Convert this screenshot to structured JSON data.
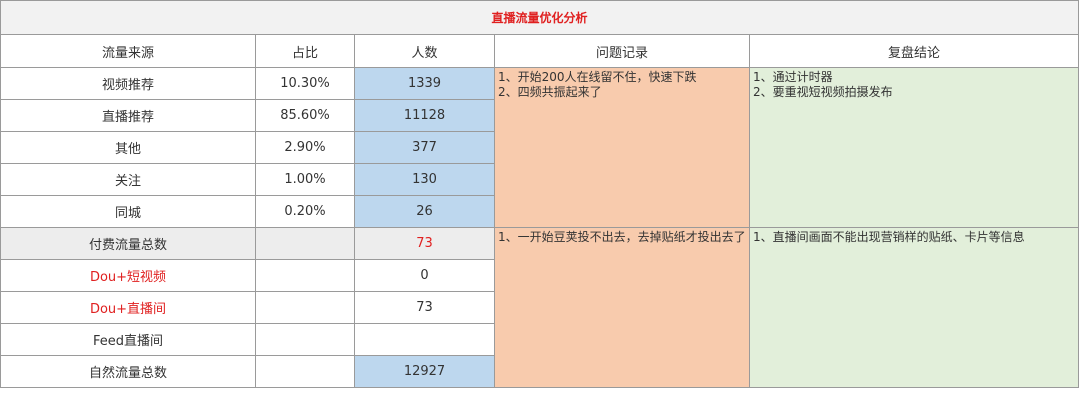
{
  "title": "直播流量优化分析",
  "headers": {
    "source": "流量来源",
    "ratio": "占比",
    "people": "人数",
    "issues": "问题记录",
    "conclusion": "复盘结论"
  },
  "rows": [
    {
      "source": "视频推荐",
      "ratio": "10.30%",
      "people": "1339"
    },
    {
      "source": "直播推荐",
      "ratio": "85.60%",
      "people": "11128"
    },
    {
      "source": "其他",
      "ratio": "2.90%",
      "people": "377"
    },
    {
      "source": "关注",
      "ratio": "1.00%",
      "people": "130"
    },
    {
      "source": "同城",
      "ratio": "0.20%",
      "people": "26"
    },
    {
      "source": "付费流量总数",
      "ratio": "",
      "people": "73"
    },
    {
      "source": "Dou+短视频",
      "ratio": "",
      "people": "0"
    },
    {
      "source": "Dou+直播间",
      "ratio": "",
      "people": "73"
    },
    {
      "source": "Feed直播间",
      "ratio": "",
      "people": ""
    },
    {
      "source": "自然流量总数",
      "ratio": "",
      "people": "12927"
    }
  ],
  "notes": {
    "issues_1": [
      "1、开始200人在线留不住，快速下跌",
      "2、四频共振起来了"
    ],
    "conclusion_1": [
      "1、通过计时器",
      "2、要重视短视频拍摄发布"
    ],
    "issues_2": [
      "1、一开始豆荚投不出去，去掉贴纸才投出去了"
    ],
    "conclusion_2": [
      "1、直播间画面不能出现营销样的贴纸、卡片等信息"
    ]
  },
  "colors": {
    "title_text": "#e02020",
    "people_fill": "#bdd7ee",
    "issues_fill": "#f8cbad",
    "conclusion_fill": "#e2efda",
    "paid_row_fill": "#ededed"
  }
}
